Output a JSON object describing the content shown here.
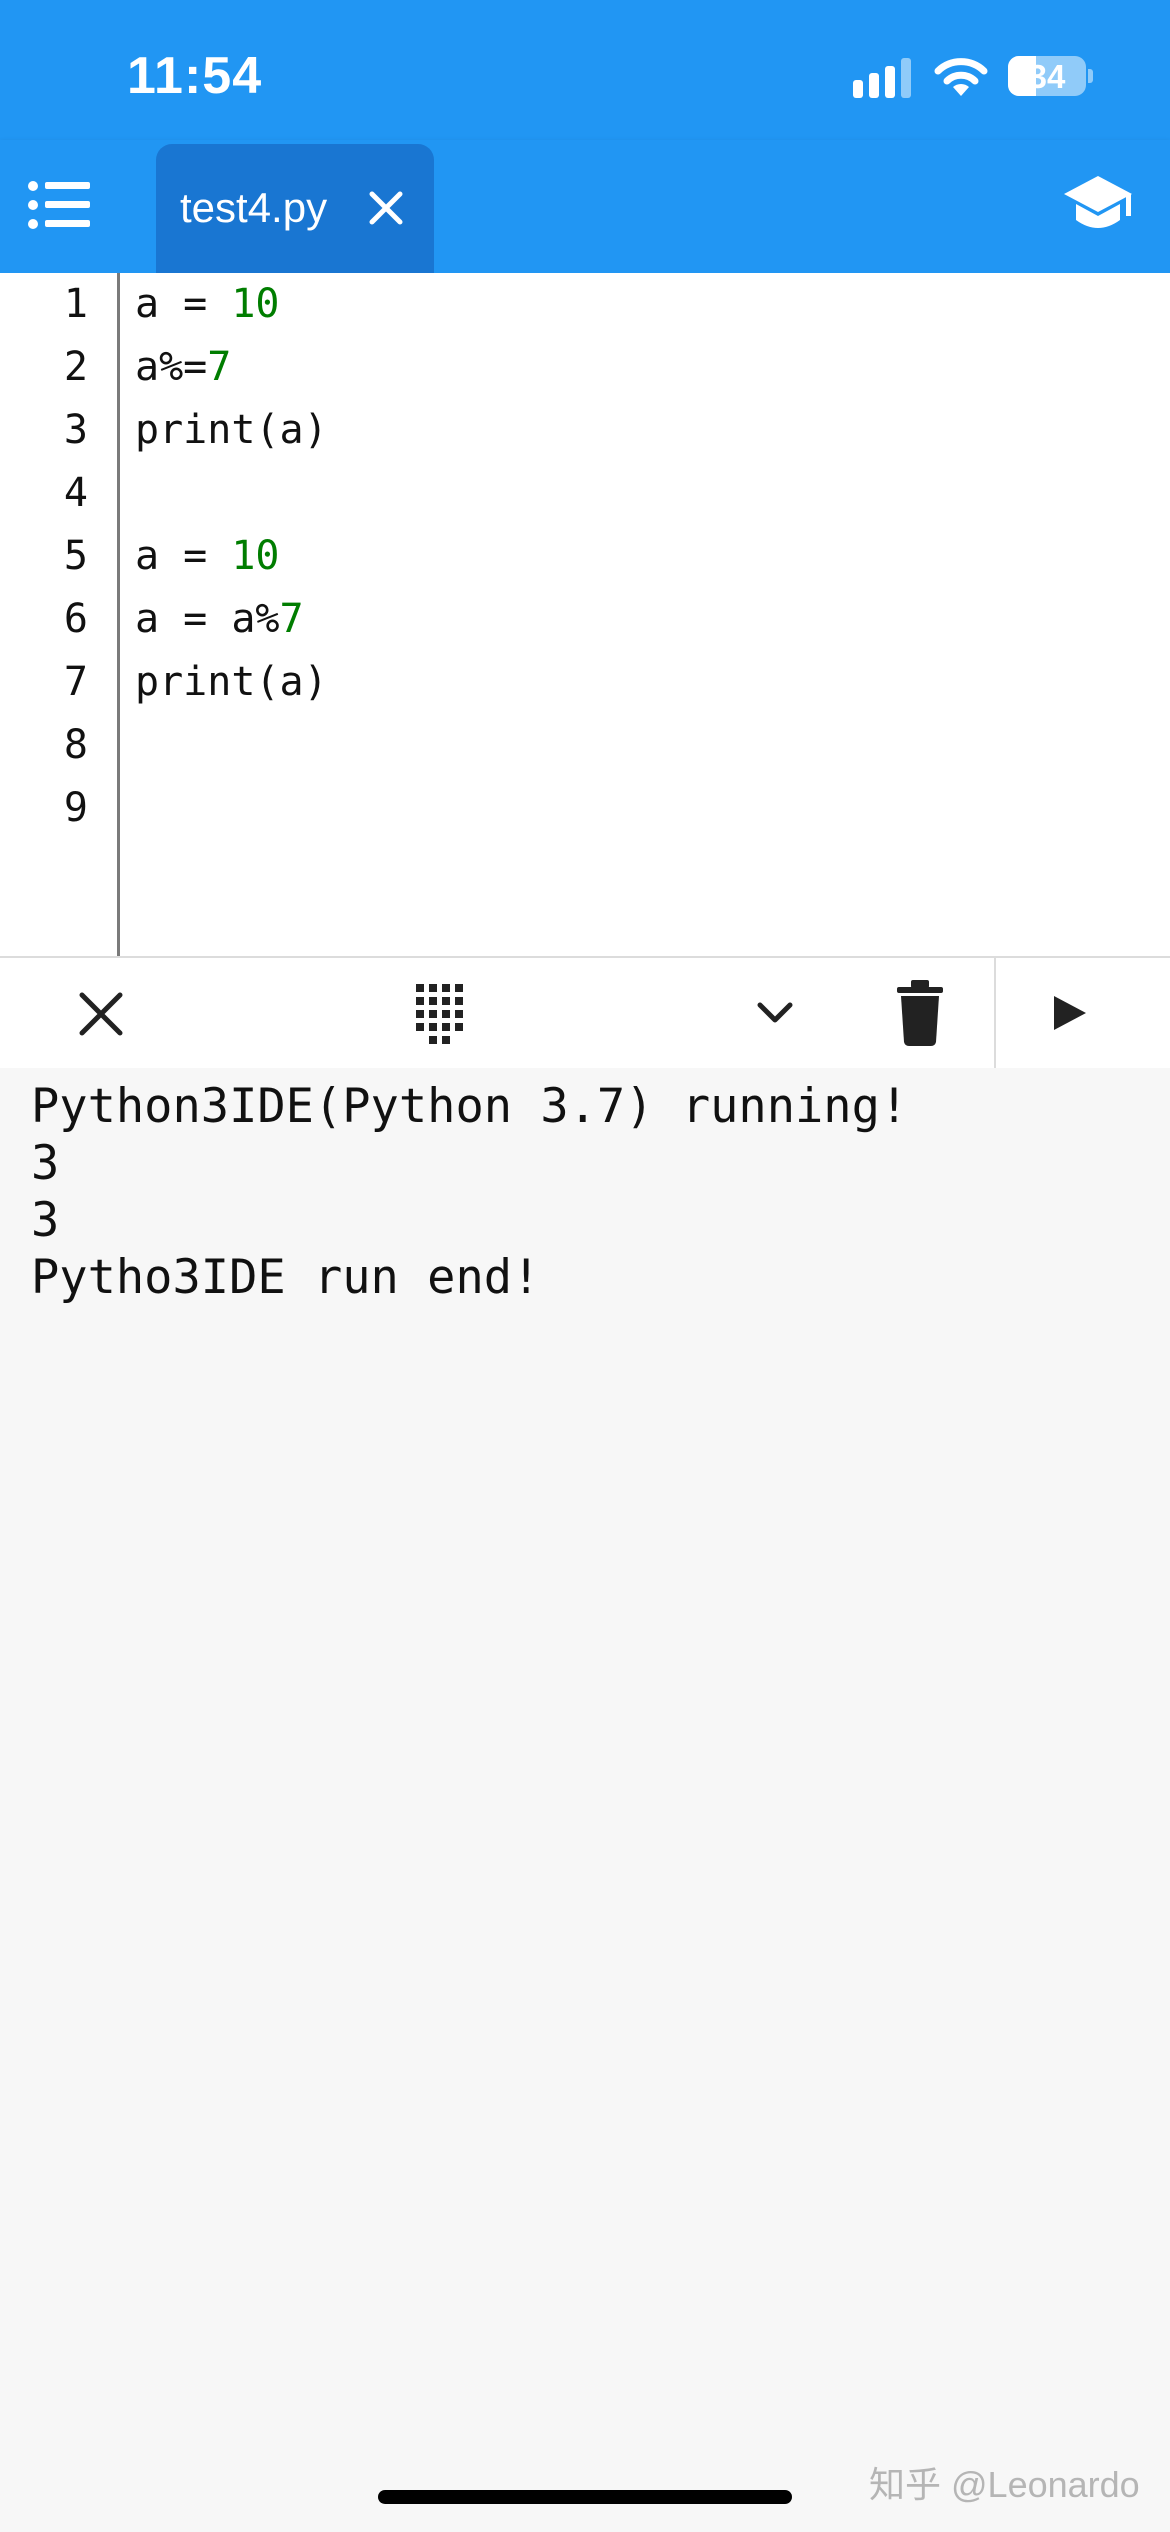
{
  "status_bar": {
    "time": "11:54",
    "battery_level": "34",
    "icons": [
      "signal-icon",
      "wifi-icon",
      "battery-icon"
    ]
  },
  "app_bar": {
    "background": "#2196f3",
    "tab_background": "#1976d2",
    "menu_icon": "menu-list-icon",
    "tab": {
      "label": "test4.py",
      "close_icon": "close-icon"
    },
    "right_icon": "school-icon"
  },
  "editor": {
    "line_numbers": [
      "1",
      "2",
      "3",
      "4",
      "5",
      "6",
      "7",
      "8",
      "9"
    ],
    "lines": [
      [
        {
          "text": "a = ",
          "type": "plain"
        },
        {
          "text": "10",
          "type": "number"
        }
      ],
      [
        {
          "text": "a%=",
          "type": "plain"
        },
        {
          "text": "7",
          "type": "number"
        }
      ],
      [
        {
          "text": "print(a)",
          "type": "plain"
        }
      ],
      [],
      [
        {
          "text": "a = ",
          "type": "plain"
        },
        {
          "text": "10",
          "type": "number"
        }
      ],
      [
        {
          "text": "a = a%",
          "type": "plain"
        },
        {
          "text": "7",
          "type": "number"
        }
      ],
      [
        {
          "text": "print(a)",
          "type": "plain"
        }
      ],
      [],
      []
    ],
    "number_color": "#007d00"
  },
  "toolbar": {
    "buttons": [
      "close-icon",
      "keypad-icon",
      "chevron-down-icon",
      "trash-icon",
      "play-icon"
    ]
  },
  "console": {
    "lines": [
      "Python3IDE(Python 3.7) running!",
      "3",
      "3",
      "Pytho3IDE run end!"
    ]
  },
  "watermark": "知乎 @Leonardo"
}
